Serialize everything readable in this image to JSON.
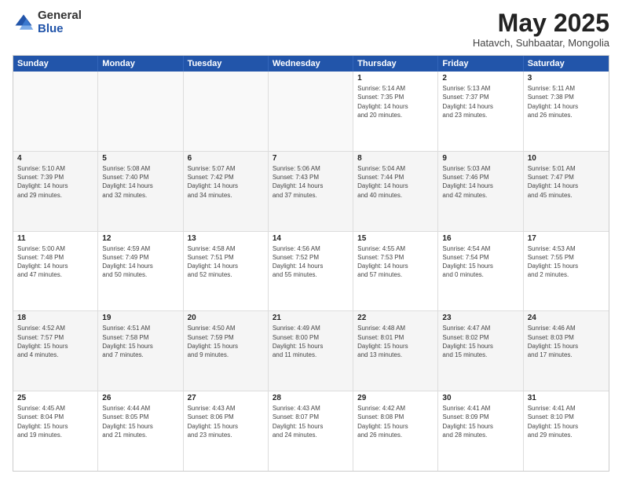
{
  "logo": {
    "general": "General",
    "blue": "Blue"
  },
  "title": "May 2025",
  "subtitle": "Hatavch, Suhbaatar, Mongolia",
  "headers": [
    "Sunday",
    "Monday",
    "Tuesday",
    "Wednesday",
    "Thursday",
    "Friday",
    "Saturday"
  ],
  "weeks": [
    [
      {
        "day": "",
        "info": "",
        "empty": true
      },
      {
        "day": "",
        "info": "",
        "empty": true
      },
      {
        "day": "",
        "info": "",
        "empty": true
      },
      {
        "day": "",
        "info": "",
        "empty": true
      },
      {
        "day": "1",
        "info": "Sunrise: 5:14 AM\nSunset: 7:35 PM\nDaylight: 14 hours\nand 20 minutes."
      },
      {
        "day": "2",
        "info": "Sunrise: 5:13 AM\nSunset: 7:37 PM\nDaylight: 14 hours\nand 23 minutes."
      },
      {
        "day": "3",
        "info": "Sunrise: 5:11 AM\nSunset: 7:38 PM\nDaylight: 14 hours\nand 26 minutes."
      }
    ],
    [
      {
        "day": "4",
        "info": "Sunrise: 5:10 AM\nSunset: 7:39 PM\nDaylight: 14 hours\nand 29 minutes."
      },
      {
        "day": "5",
        "info": "Sunrise: 5:08 AM\nSunset: 7:40 PM\nDaylight: 14 hours\nand 32 minutes."
      },
      {
        "day": "6",
        "info": "Sunrise: 5:07 AM\nSunset: 7:42 PM\nDaylight: 14 hours\nand 34 minutes."
      },
      {
        "day": "7",
        "info": "Sunrise: 5:06 AM\nSunset: 7:43 PM\nDaylight: 14 hours\nand 37 minutes."
      },
      {
        "day": "8",
        "info": "Sunrise: 5:04 AM\nSunset: 7:44 PM\nDaylight: 14 hours\nand 40 minutes."
      },
      {
        "day": "9",
        "info": "Sunrise: 5:03 AM\nSunset: 7:46 PM\nDaylight: 14 hours\nand 42 minutes."
      },
      {
        "day": "10",
        "info": "Sunrise: 5:01 AM\nSunset: 7:47 PM\nDaylight: 14 hours\nand 45 minutes."
      }
    ],
    [
      {
        "day": "11",
        "info": "Sunrise: 5:00 AM\nSunset: 7:48 PM\nDaylight: 14 hours\nand 47 minutes."
      },
      {
        "day": "12",
        "info": "Sunrise: 4:59 AM\nSunset: 7:49 PM\nDaylight: 14 hours\nand 50 minutes."
      },
      {
        "day": "13",
        "info": "Sunrise: 4:58 AM\nSunset: 7:51 PM\nDaylight: 14 hours\nand 52 minutes."
      },
      {
        "day": "14",
        "info": "Sunrise: 4:56 AM\nSunset: 7:52 PM\nDaylight: 14 hours\nand 55 minutes."
      },
      {
        "day": "15",
        "info": "Sunrise: 4:55 AM\nSunset: 7:53 PM\nDaylight: 14 hours\nand 57 minutes."
      },
      {
        "day": "16",
        "info": "Sunrise: 4:54 AM\nSunset: 7:54 PM\nDaylight: 15 hours\nand 0 minutes."
      },
      {
        "day": "17",
        "info": "Sunrise: 4:53 AM\nSunset: 7:55 PM\nDaylight: 15 hours\nand 2 minutes."
      }
    ],
    [
      {
        "day": "18",
        "info": "Sunrise: 4:52 AM\nSunset: 7:57 PM\nDaylight: 15 hours\nand 4 minutes."
      },
      {
        "day": "19",
        "info": "Sunrise: 4:51 AM\nSunset: 7:58 PM\nDaylight: 15 hours\nand 7 minutes."
      },
      {
        "day": "20",
        "info": "Sunrise: 4:50 AM\nSunset: 7:59 PM\nDaylight: 15 hours\nand 9 minutes."
      },
      {
        "day": "21",
        "info": "Sunrise: 4:49 AM\nSunset: 8:00 PM\nDaylight: 15 hours\nand 11 minutes."
      },
      {
        "day": "22",
        "info": "Sunrise: 4:48 AM\nSunset: 8:01 PM\nDaylight: 15 hours\nand 13 minutes."
      },
      {
        "day": "23",
        "info": "Sunrise: 4:47 AM\nSunset: 8:02 PM\nDaylight: 15 hours\nand 15 minutes."
      },
      {
        "day": "24",
        "info": "Sunrise: 4:46 AM\nSunset: 8:03 PM\nDaylight: 15 hours\nand 17 minutes."
      }
    ],
    [
      {
        "day": "25",
        "info": "Sunrise: 4:45 AM\nSunset: 8:04 PM\nDaylight: 15 hours\nand 19 minutes."
      },
      {
        "day": "26",
        "info": "Sunrise: 4:44 AM\nSunset: 8:05 PM\nDaylight: 15 hours\nand 21 minutes."
      },
      {
        "day": "27",
        "info": "Sunrise: 4:43 AM\nSunset: 8:06 PM\nDaylight: 15 hours\nand 23 minutes."
      },
      {
        "day": "28",
        "info": "Sunrise: 4:43 AM\nSunset: 8:07 PM\nDaylight: 15 hours\nand 24 minutes."
      },
      {
        "day": "29",
        "info": "Sunrise: 4:42 AM\nSunset: 8:08 PM\nDaylight: 15 hours\nand 26 minutes."
      },
      {
        "day": "30",
        "info": "Sunrise: 4:41 AM\nSunset: 8:09 PM\nDaylight: 15 hours\nand 28 minutes."
      },
      {
        "day": "31",
        "info": "Sunrise: 4:41 AM\nSunset: 8:10 PM\nDaylight: 15 hours\nand 29 minutes."
      }
    ]
  ]
}
